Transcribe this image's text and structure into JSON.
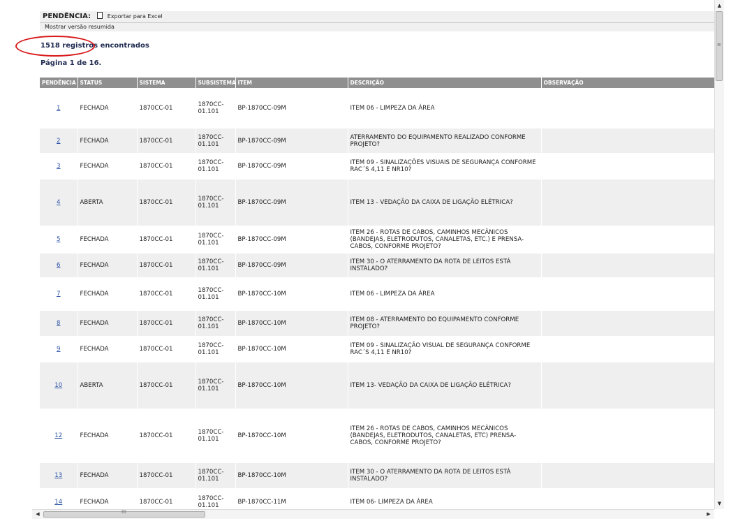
{
  "toolbar": {
    "title": "PENDÊNCIA:",
    "export_label": "Exportar para Excel",
    "doc_icon": "document-icon"
  },
  "subbar": {
    "summary_link": "Mostrar versão resumida"
  },
  "summary": {
    "records_found": "1518 registros encontrados",
    "page_info": "Página 1 de 16."
  },
  "table": {
    "headers": [
      "PENDÊNCIA",
      "STATUS",
      "SISTEMA",
      "SUBSISTEMA",
      "ITEM",
      "DESCRIÇÃO",
      "OBSERVAÇÃO"
    ],
    "rows": [
      {
        "id": "1",
        "status": "FECHADA",
        "sistema": "1870CC-01",
        "subsistema": "1870CC-\n01.101",
        "item": "BP-1870CC-09M",
        "descricao": "ITEM 06 - LIMPEZA DA ÁREA",
        "observacao": ""
      },
      {
        "id": "2",
        "status": "FECHADA",
        "sistema": "1870CC-01",
        "subsistema": "1870CC-\n01.101",
        "item": "BP-1870CC-09M",
        "descricao": "ATERRAMENTO DO EQUIPAMENTO REALIZADO CONFORME PROJETO?",
        "observacao": ""
      },
      {
        "id": "3",
        "status": "FECHADA",
        "sistema": "1870CC-01",
        "subsistema": "1870CC-\n01.101",
        "item": "BP-1870CC-09M",
        "descricao": "ITEM 09 - SINALIZAÇÕES VISUAIS DE SEGURANÇA CONFORME RAC´S 4,11 E NR10?",
        "observacao": ""
      },
      {
        "id": "4",
        "status": "ABERTA",
        "sistema": "1870CC-01",
        "subsistema": "1870CC-\n01.101",
        "item": "BP-1870CC-09M",
        "descricao": "ITEM 13 - VEDAÇÃO DA CAIXA DE LIGAÇÃO ELÉTRICA?",
        "observacao": ""
      },
      {
        "id": "5",
        "status": "FECHADA",
        "sistema": "1870CC-01",
        "subsistema": "1870CC-\n01.101",
        "item": "BP-1870CC-09M",
        "descricao": "ITEM 26 - ROTAS DE CABOS, CAMINHOS MECÂNICOS (BANDEJAS, ELETRODUTOS, CANALETAS, ETC.) E PRENSA-CABOS, CONFORME PROJETO?",
        "observacao": ""
      },
      {
        "id": "6",
        "status": "FECHADA",
        "sistema": "1870CC-01",
        "subsistema": "1870CC-\n01.101",
        "item": "BP-1870CC-09M",
        "descricao": "ITEM 30 - O ATERRAMENTO DA ROTA DE LEITOS ESTÁ INSTALADO?",
        "observacao": ""
      },
      {
        "id": "7",
        "status": "FECHADA",
        "sistema": "1870CC-01",
        "subsistema": "1870CC-\n01.101",
        "item": "BP-1870CC-10M",
        "descricao": "ITEM 06 - LIMPEZA DA ÁREA",
        "observacao": ""
      },
      {
        "id": "8",
        "status": "FECHADA",
        "sistema": "1870CC-01",
        "subsistema": "1870CC-\n01.101",
        "item": "BP-1870CC-10M",
        "descricao": "ITEM 08 - ATERRAMENTO DO EQUIPAMENTO CONFORME PROJETO?",
        "observacao": ""
      },
      {
        "id": "9",
        "status": "FECHADA",
        "sistema": "1870CC-01",
        "subsistema": "1870CC-\n01.101",
        "item": "BP-1870CC-10M",
        "descricao": "ITEM 09 - SINALIZAÇÃO VISUAL DE SEGURANÇA CONFORME RAC´S 4,11 E NR10?",
        "observacao": ""
      },
      {
        "id": "10",
        "status": "ABERTA",
        "sistema": "1870CC-01",
        "subsistema": "1870CC-\n01.101",
        "item": "BP-1870CC-10M",
        "descricao": "ITEM 13- VEDAÇÃO DA CAIXA DE LIGAÇÃO ELÉTRICA?",
        "observacao": ""
      },
      {
        "id": "12",
        "status": "FECHADA",
        "sistema": "1870CC-01",
        "subsistema": "1870CC-\n01.101",
        "item": "BP-1870CC-10M",
        "descricao": "ITEM 26 - ROTAS DE CABOS, CAMINHOS MECÂNICOS (BANDEJAS, ELETRODUTOS, CANALETAS, ETC) PRENSA-CABOS, CONFORME PROJETO?",
        "observacao": ""
      },
      {
        "id": "13",
        "status": "FECHADA",
        "sistema": "1870CC-01",
        "subsistema": "1870CC-\n01.101",
        "item": "BP-1870CC-10M",
        "descricao": "ITEM 30 - O ATERRAMENTO DA ROTA DE LEITOS ESTÁ INSTALADO?",
        "observacao": ""
      },
      {
        "id": "14",
        "status": "FECHADA",
        "sistema": "1870CC-01",
        "subsistema": "1870CC-\n01.101",
        "item": "BP-1870CC-11M",
        "descricao": "ITEM 06- LIMPEZA DA ÁREA",
        "observacao": ""
      }
    ]
  },
  "scrollbars": {
    "grip": "≡",
    "hgrip": "III"
  },
  "colors": {
    "header_bg": "#8f8f8f",
    "link": "#2b53a6",
    "highlight_oval": "#d8191a",
    "row_alt": "#efefef"
  }
}
